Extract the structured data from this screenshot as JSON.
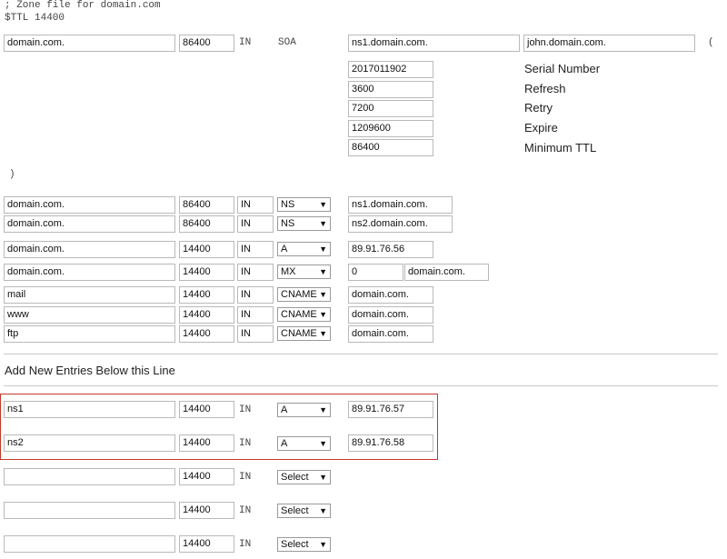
{
  "header": {
    "comment": "; Zone file for domain.com",
    "ttl": "$TTL 14400"
  },
  "soa": {
    "name": "domain.com.",
    "ttl": "86400",
    "class": "IN",
    "type": "SOA",
    "primary_ns": "ns1.domain.com.",
    "admin": "john.domain.com.",
    "open_paren": "(",
    "close_paren": ")",
    "fields": [
      {
        "value": "2017011902",
        "label": "Serial Number"
      },
      {
        "value": "3600",
        "label": "Refresh"
      },
      {
        "value": "7200",
        "label": "Retry"
      },
      {
        "value": "1209600",
        "label": "Expire"
      },
      {
        "value": "86400",
        "label": "Minimum TTL"
      }
    ]
  },
  "records": [
    {
      "name": "domain.com.",
      "ttl": "86400",
      "class": "IN",
      "type": "NS",
      "value": "ns1.domain.com."
    },
    {
      "name": "domain.com.",
      "ttl": "86400",
      "class": "IN",
      "type": "NS",
      "value": "ns2.domain.com."
    },
    {
      "name": "domain.com.",
      "ttl": "14400",
      "class": "IN",
      "type": "A",
      "value": "89.91.76.56"
    },
    {
      "name": "domain.com.",
      "ttl": "14400",
      "class": "IN",
      "type": "MX",
      "priority": "0",
      "value": "domain.com."
    },
    {
      "name": "mail",
      "ttl": "14400",
      "class": "IN",
      "type": "CNAME",
      "value": "domain.com."
    },
    {
      "name": "www",
      "ttl": "14400",
      "class": "IN",
      "type": "CNAME",
      "value": "domain.com."
    },
    {
      "name": "ftp",
      "ttl": "14400",
      "class": "IN",
      "type": "CNAME",
      "value": "domain.com."
    }
  ],
  "new_section_title": "Add New Entries Below this Line",
  "new_entries": [
    {
      "name": "ns1",
      "ttl": "14400",
      "class": "IN",
      "type": "A",
      "value": "89.91.76.57"
    },
    {
      "name": "ns2",
      "ttl": "14400",
      "class": "IN",
      "type": "A",
      "value": "89.91.76.58"
    },
    {
      "name": "",
      "ttl": "14400",
      "class": "IN",
      "type": "Select",
      "value": ""
    },
    {
      "name": "",
      "ttl": "14400",
      "class": "IN",
      "type": "Select",
      "value": ""
    },
    {
      "name": "",
      "ttl": "14400",
      "class": "IN",
      "type": "Select",
      "value": ""
    }
  ],
  "icons": {
    "dropdown": "dropdown-arrow-icon"
  }
}
